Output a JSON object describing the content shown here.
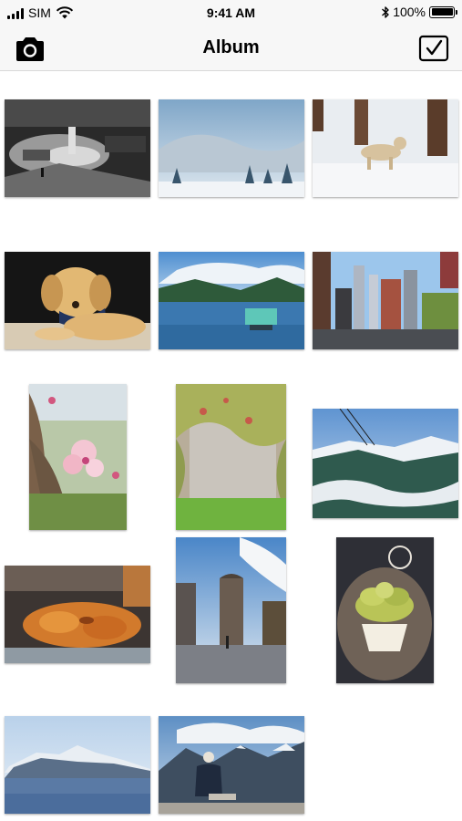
{
  "status_bar": {
    "carrier": "SIM",
    "time": "9:41 AM",
    "battery_percent": "100%",
    "battery_level": 1.0,
    "icons": [
      "signal-icon",
      "wifi-icon",
      "bluetooth-icon",
      "battery-icon"
    ]
  },
  "nav": {
    "title": "Album",
    "left_icon": "camera-icon",
    "right_icon": "select-checkbox-icon"
  },
  "photos": [
    {
      "id": "garden",
      "subject": "black-and-white garden with fountain"
    },
    {
      "id": "misty-forest",
      "subject": "misty snowy forest"
    },
    {
      "id": "dog-snow",
      "subject": "dog running in snow"
    },
    {
      "id": "puppy",
      "subject": "yellow lab puppy with bandana"
    },
    {
      "id": "lake-house",
      "subject": "lake with cabin and mountains"
    },
    {
      "id": "city-street",
      "subject": "city street with towers"
    },
    {
      "id": "blossom",
      "subject": "pink cherry blossom"
    },
    {
      "id": "ivy-wall",
      "subject": "ivy covered wall"
    },
    {
      "id": "mountain-clouds",
      "subject": "mountains above clouds"
    },
    {
      "id": "pastries",
      "subject": "pastries in a bakery case"
    },
    {
      "id": "flatiron",
      "subject": "flatiron building street"
    },
    {
      "id": "succulent",
      "subject": "succulent in a pot"
    },
    {
      "id": "snowy-peaks",
      "subject": "snowy peaks over sea"
    },
    {
      "id": "hiker",
      "subject": "person sitting by mountains"
    }
  ]
}
